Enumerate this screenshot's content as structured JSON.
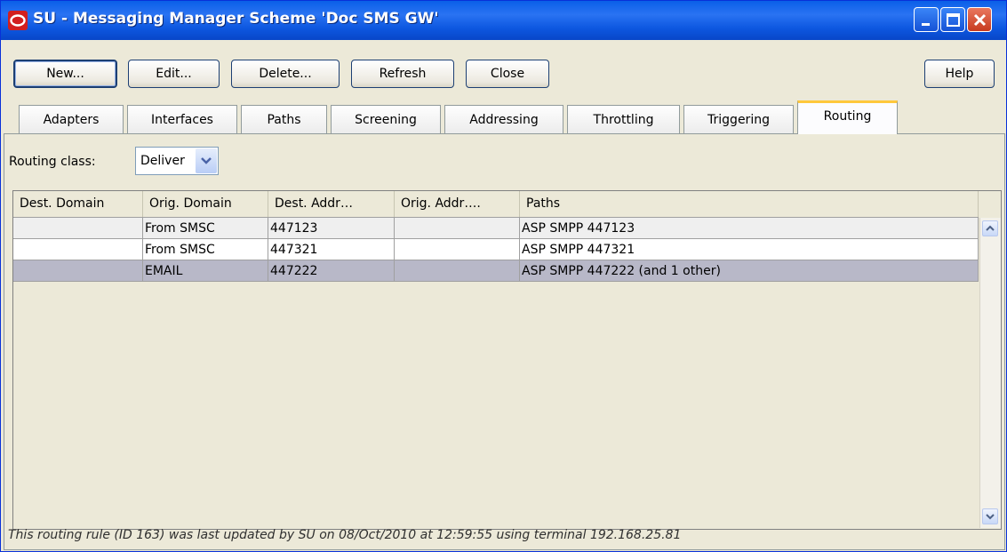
{
  "window": {
    "title": "SU - Messaging Manager Scheme 'Doc SMS GW'",
    "controls": [
      "minimize-icon",
      "maximize-icon",
      "close-icon"
    ]
  },
  "toolbar": {
    "new_label": "New...",
    "edit_label": "Edit...",
    "delete_label": "Delete...",
    "refresh_label": "Refresh",
    "close_label": "Close",
    "help_label": "Help"
  },
  "tabs": [
    {
      "label": "Adapters"
    },
    {
      "label": "Interfaces"
    },
    {
      "label": "Paths"
    },
    {
      "label": "Screening"
    },
    {
      "label": "Addressing"
    },
    {
      "label": "Throttling"
    },
    {
      "label": "Triggering"
    },
    {
      "label": "Routing",
      "active": true
    }
  ],
  "routing": {
    "class_label": "Routing class:",
    "class_value": "Deliver"
  },
  "table": {
    "columns": [
      "Dest. Domain",
      "Orig. Domain",
      "Dest. Addr…",
      "Orig. Addr….",
      "Paths"
    ],
    "rows": [
      {
        "dest_domain": "",
        "orig_domain": "From SMSC",
        "dest_addr": "447123",
        "orig_addr": "",
        "paths": "ASP SMPP 447123"
      },
      {
        "dest_domain": "",
        "orig_domain": "From SMSC",
        "dest_addr": "447321",
        "orig_addr": "",
        "paths": "ASP SMPP 447321"
      },
      {
        "dest_domain": "",
        "orig_domain": "EMAIL",
        "dest_addr": "447222",
        "orig_addr": "",
        "paths": "ASP SMPP 447222 (and 1 other)",
        "selected": true
      }
    ]
  },
  "status": {
    "text": "This routing rule (ID 163) was last updated by SU on 08/Oct/2010 at 12:59:55 using terminal 192.168.25.81"
  },
  "colors": {
    "titlebar": "#0a5fe8",
    "active_tab_accent": "#ffc83c",
    "selected_row": "#b8b8c8"
  }
}
